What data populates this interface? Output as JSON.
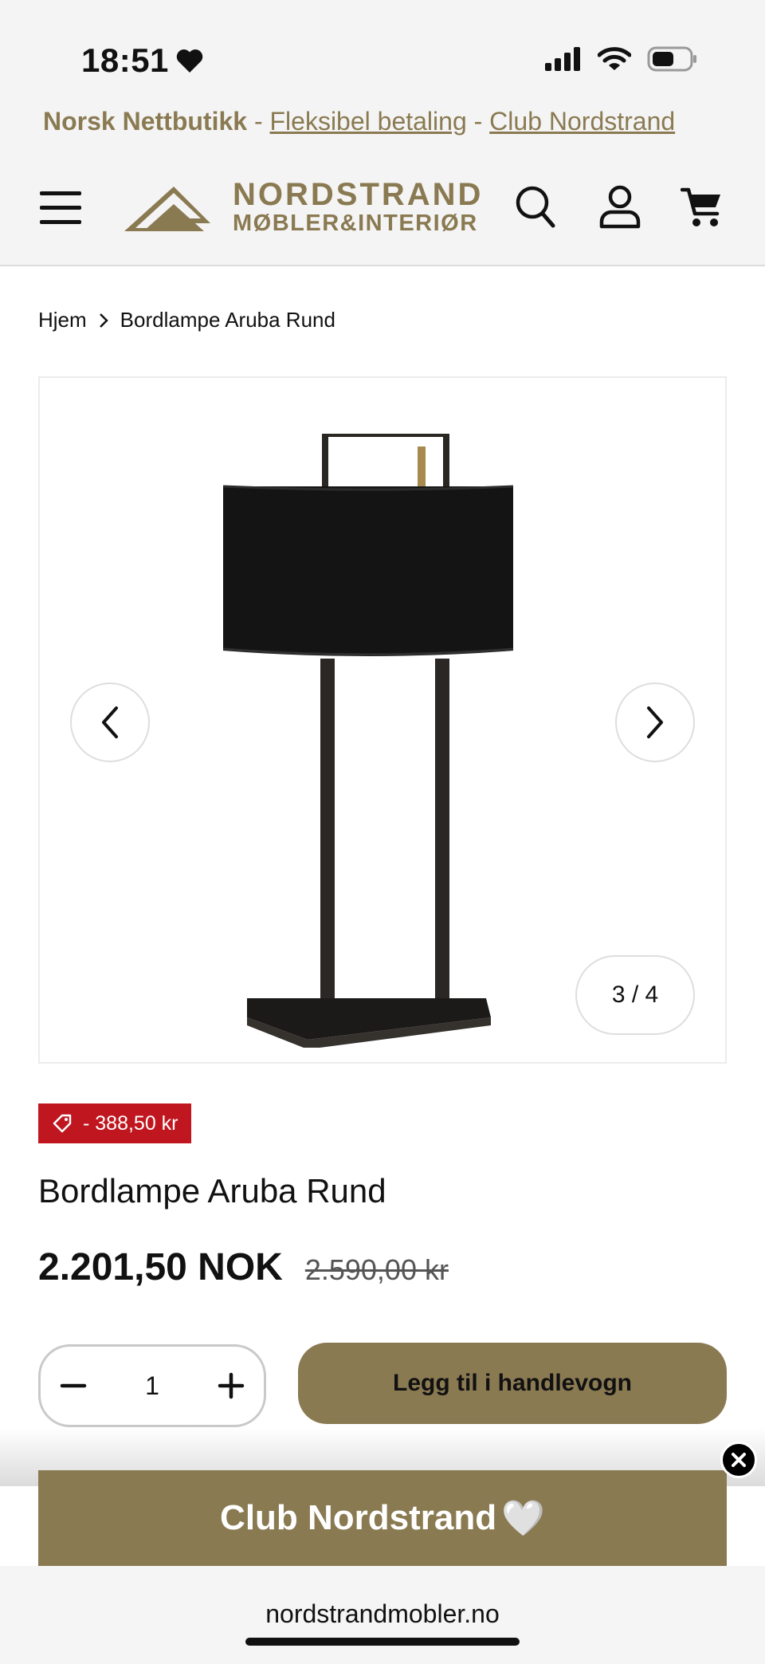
{
  "status_bar": {
    "time": "18:51"
  },
  "announcement": {
    "shop": "Norsk Nettbutikk",
    "sep1": " - ",
    "payment": "Fleksibel betaling",
    "sep2": " - ",
    "club": "Club Nordstrand"
  },
  "header": {
    "logo_line1": "NORDSTRAND",
    "logo_line2": "MØBLER&INTERIØR",
    "brand_color": "#8a7a52"
  },
  "breadcrumb": {
    "home": "Hjem",
    "current": "Bordlampe Aruba Rund"
  },
  "gallery": {
    "counter": "3 / 4"
  },
  "product": {
    "discount": "- 388,50 kr",
    "title": "Bordlampe Aruba Rund",
    "price": "2.201,50 NOK",
    "old_price": "2.590,00 kr",
    "quantity": "1",
    "add_to_cart": "Legg til i handlevogn"
  },
  "promo": {
    "club_label": "Club Nordstrand",
    "heart": "🤍"
  },
  "browser": {
    "url": "nordstrandmobler.no"
  },
  "colors": {
    "accent": "#8a7a52",
    "sale": "#c0161f"
  }
}
